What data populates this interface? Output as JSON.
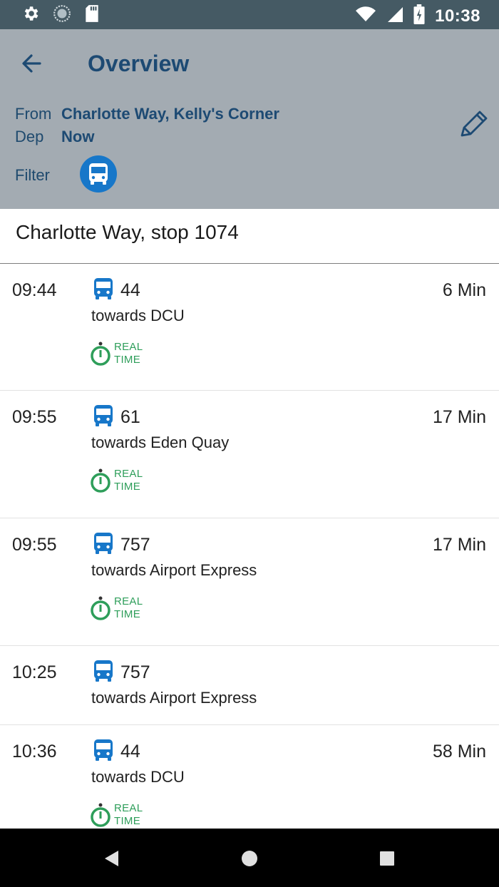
{
  "status_bar": {
    "time": "10:38",
    "left_icons": [
      "gear-icon",
      "sync-icon",
      "sd-card-icon"
    ],
    "right_icons": [
      "wifi-icon",
      "signal-icon",
      "battery-icon"
    ]
  },
  "header": {
    "title": "Overview",
    "from_label": "From",
    "from_value": "Charlotte Way, Kelly's Corner",
    "dep_label": "Dep",
    "dep_value": "Now",
    "filter_label": "Filter"
  },
  "stop": {
    "title": "Charlotte Way, stop 1074"
  },
  "departures": [
    {
      "time": "09:44",
      "route": "44",
      "towards": "towards DCU",
      "mins": "6 Min",
      "realtime": true,
      "rt_line1": "REAL",
      "rt_line2": "TIME"
    },
    {
      "time": "09:55",
      "route": "61",
      "towards": "towards Eden Quay",
      "mins": "17 Min",
      "realtime": true,
      "rt_line1": "REAL",
      "rt_line2": "TIME"
    },
    {
      "time": "09:55",
      "route": "757",
      "towards": "towards Airport Express",
      "mins": "17 Min",
      "realtime": true,
      "rt_line1": "REAL",
      "rt_line2": "TIME"
    },
    {
      "time": "10:25",
      "route": "757",
      "towards": "towards Airport Express",
      "mins": "",
      "realtime": false
    },
    {
      "time": "10:36",
      "route": "44",
      "towards": "towards DCU",
      "mins": "58 Min",
      "realtime": true,
      "rt_line1": "REAL",
      "rt_line2": "TIME"
    }
  ],
  "colors": {
    "status_bar": "#455a64",
    "header_bg": "#a3abb2",
    "title_text": "#1d4a73",
    "accent_blue": "#1777c9",
    "realtime_green": "#2e9e5a"
  }
}
